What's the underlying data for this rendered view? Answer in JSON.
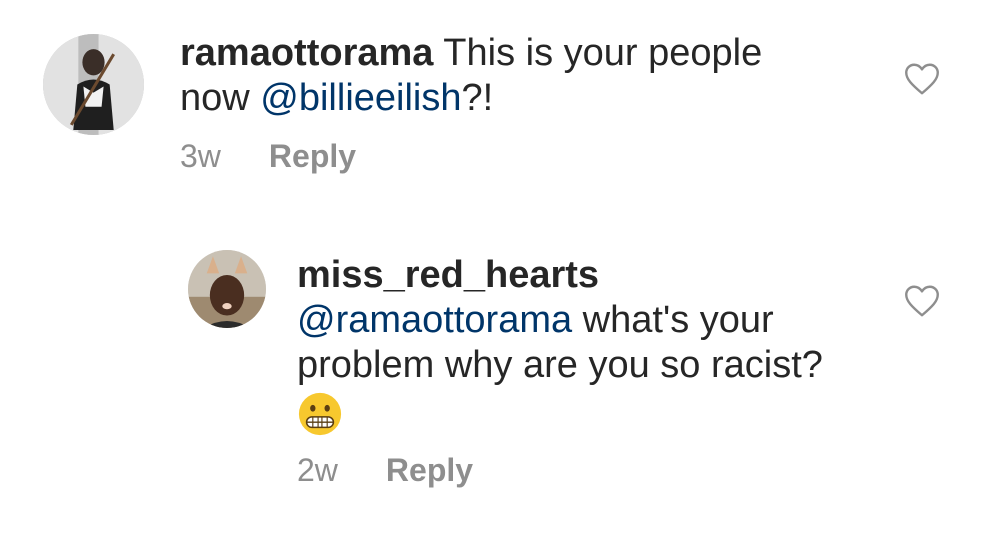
{
  "comments": [
    {
      "username": "ramaottorama",
      "text_before": " This is your people now ",
      "mention": "@billieeilish",
      "text_after": "?!",
      "time": "3w",
      "reply_label": "Reply",
      "avatar_icon": "avatar-photo",
      "like_icon": "heart-outline-icon"
    },
    {
      "username": "miss_red_hearts",
      "mention": "@ramaottorama",
      "text_after": " what's your problem why are you so racist?",
      "emoji": "grimacing-face",
      "time": "2w",
      "reply_label": "Reply",
      "avatar_icon": "avatar-photo",
      "like_icon": "heart-outline-icon"
    }
  ],
  "colors": {
    "text": "#262626",
    "mention": "#003569",
    "meta": "#8e8e8e",
    "heart": "#8e8e8e"
  }
}
